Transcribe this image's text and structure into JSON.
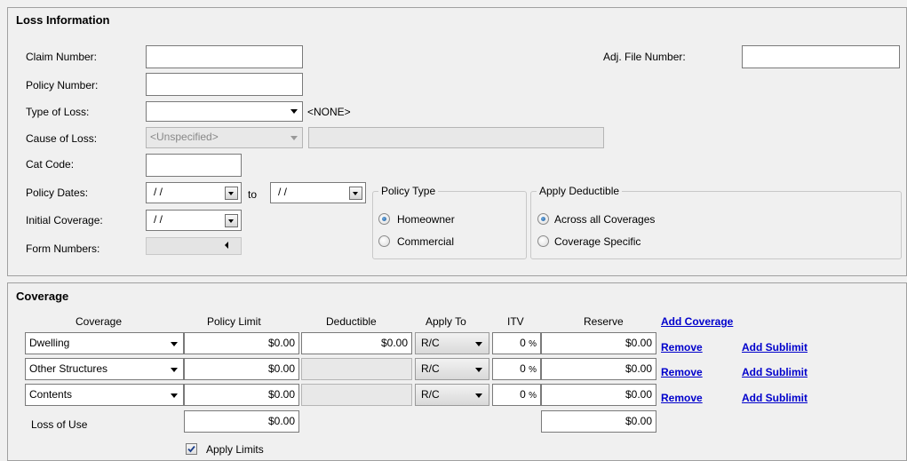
{
  "loss_info": {
    "title": "Loss Information",
    "claim_number": {
      "label": "Claim Number:",
      "value": ""
    },
    "adj_file_number": {
      "label": "Adj. File Number:",
      "value": ""
    },
    "policy_number": {
      "label": "Policy Number:",
      "value": ""
    },
    "type_of_loss": {
      "label": "Type of Loss:",
      "value": "",
      "display": "<NONE>"
    },
    "cause_of_loss": {
      "label": "Cause of Loss:",
      "value": "<Unspecified>",
      "detail": ""
    },
    "cat_code": {
      "label": "Cat Code:",
      "value": ""
    },
    "policy_dates": {
      "label": "Policy Dates:",
      "from": " /  /",
      "to_label": "to",
      "to": " /  /"
    },
    "initial_coverage": {
      "label": "Initial Coverage:",
      "value": " /  /"
    },
    "form_numbers": {
      "label": "Form Numbers:"
    },
    "policy_type": {
      "title": "Policy Type",
      "options": [
        "Homeowner",
        "Commercial"
      ],
      "selected": "Homeowner"
    },
    "apply_deductible": {
      "title": "Apply Deductible",
      "options": [
        "Across all Coverages",
        "Coverage Specific"
      ],
      "selected": "Across all Coverages"
    }
  },
  "coverage": {
    "title": "Coverage",
    "headers": {
      "coverage": "Coverage",
      "policy_limit": "Policy Limit",
      "deductible": "Deductible",
      "apply_to": "Apply To",
      "itv": "ITV",
      "reserve": "Reserve"
    },
    "add_coverage": "Add Coverage",
    "rows": [
      {
        "name": "Dwelling",
        "policy_limit": "$0.00",
        "deductible": "$0.00",
        "apply_to": "R/C",
        "itv": "0",
        "itv_unit": "%",
        "reserve": "$0.00",
        "remove": "Remove",
        "add_sublimit": "Add Sublimit"
      },
      {
        "name": "Other Structures",
        "policy_limit": "$0.00",
        "deductible": "",
        "apply_to": "R/C",
        "itv": "0",
        "itv_unit": "%",
        "reserve": "$0.00",
        "remove": "Remove",
        "add_sublimit": "Add Sublimit"
      },
      {
        "name": "Contents",
        "policy_limit": "$0.00",
        "deductible": "",
        "apply_to": "R/C",
        "itv": "0",
        "itv_unit": "%",
        "reserve": "$0.00",
        "remove": "Remove",
        "add_sublimit": "Add Sublimit"
      }
    ],
    "loss_of_use": {
      "label": "Loss of Use",
      "policy_limit": "$0.00",
      "reserve": "$0.00"
    },
    "apply_limits": {
      "label": "Apply Limits",
      "checked": true
    }
  }
}
